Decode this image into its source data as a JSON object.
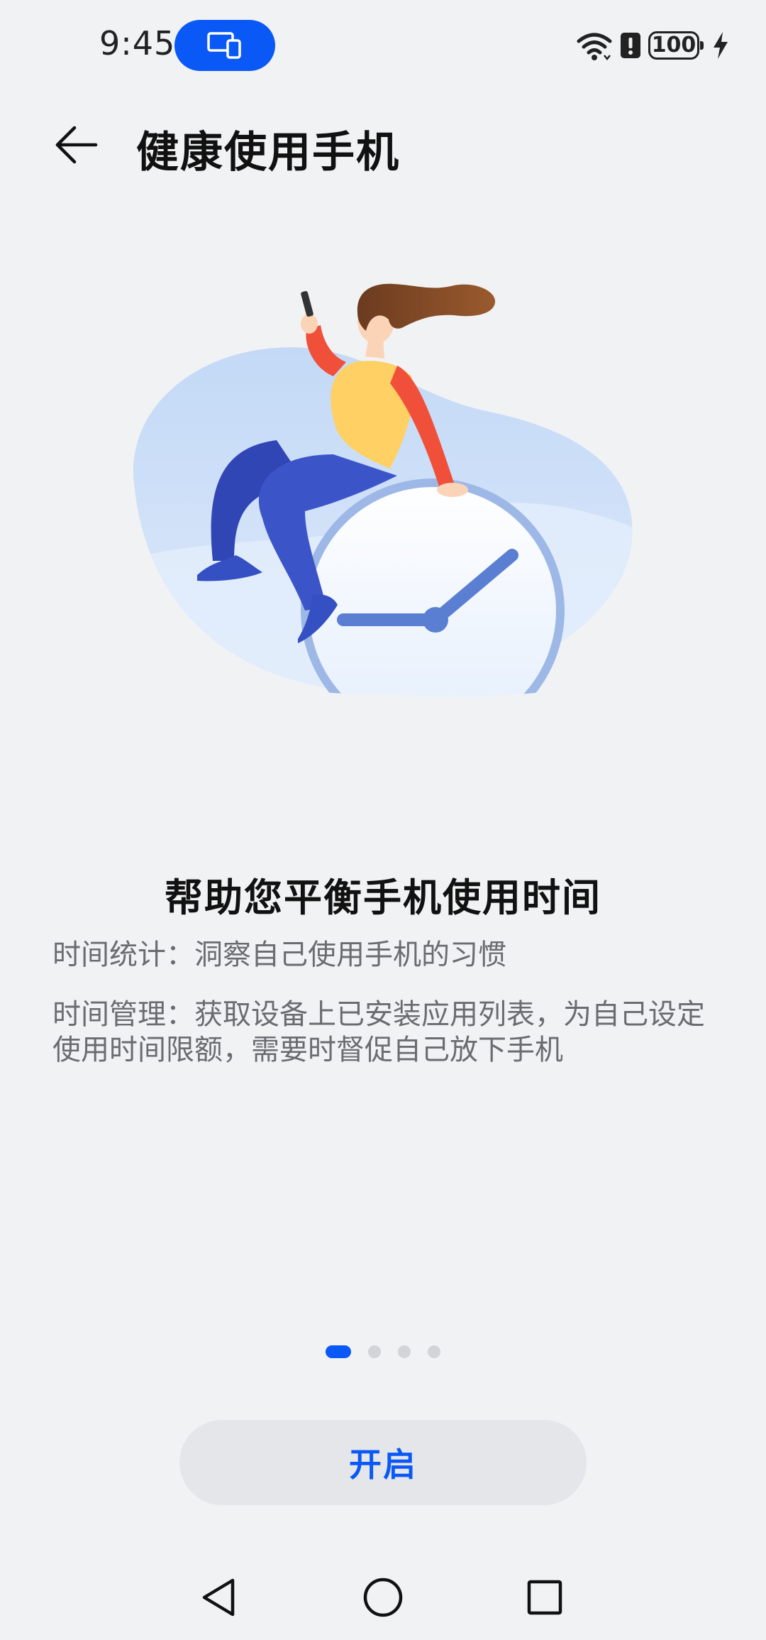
{
  "status_bar": {
    "time": "9:45",
    "battery_level": "100",
    "icons": [
      "screen-cast-icon",
      "wifi-icon",
      "alert-icon",
      "battery-icon",
      "charging-icon"
    ]
  },
  "header": {
    "title": "健康使用手机",
    "back_icon": "arrow-left-icon"
  },
  "illustration": {
    "subject": "woman-sitting-on-clock-illustration"
  },
  "content": {
    "heading": "帮助您平衡手机使用时间",
    "line_1": "时间统计：洞察自己使用手机的习惯",
    "line_2": "时间管理：获取设备上已安装应用列表，为自己设定使用时间限额，需要时督促自己放下手机"
  },
  "pagination": {
    "current": 1,
    "total": 4
  },
  "primary_action": {
    "label": "开启"
  },
  "nav_bar": {
    "icons": [
      "triangle-back-icon",
      "circle-home-icon",
      "square-recent-icon"
    ]
  },
  "colors": {
    "accent": "#0a59f7",
    "background": "#f1f2f4",
    "button_bg": "#e5e6e9",
    "secondary_text": "#6b6c70"
  }
}
